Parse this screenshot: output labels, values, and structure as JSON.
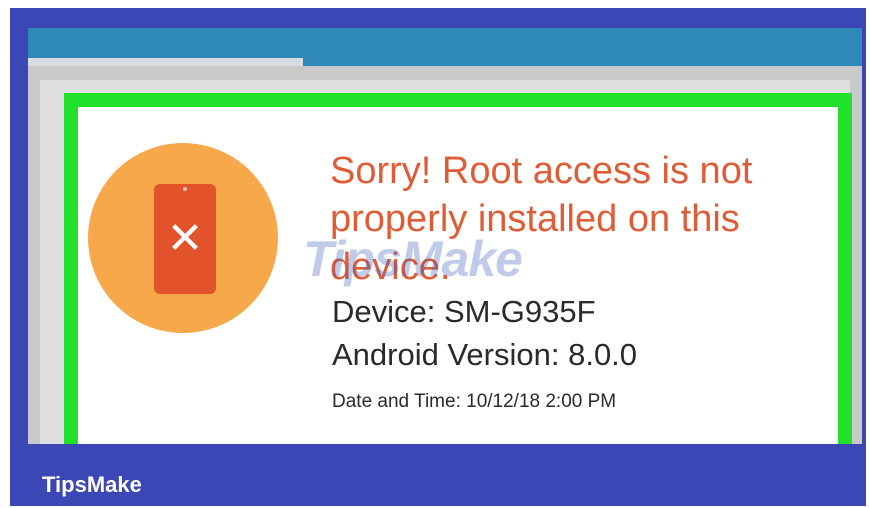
{
  "dialog": {
    "title": "Sorry! Root access is not properly installed on this device.",
    "device": "Device: SM-G935F",
    "android_version": "Android Version: 8.0.0",
    "date_time": "Date and Time: 10/12/18 2:00 PM"
  },
  "icon": {
    "name": "phone-error-icon",
    "symbol": "✕"
  },
  "watermark": "TipsMake",
  "brand": "TipsMake",
  "colors": {
    "frame": "#3a47b4",
    "app_bar": "#2e88b8",
    "highlight_border": "#22e12a",
    "icon_circle": "#f6a84a",
    "phone": "#e2532c",
    "title_text": "#df5d36"
  }
}
